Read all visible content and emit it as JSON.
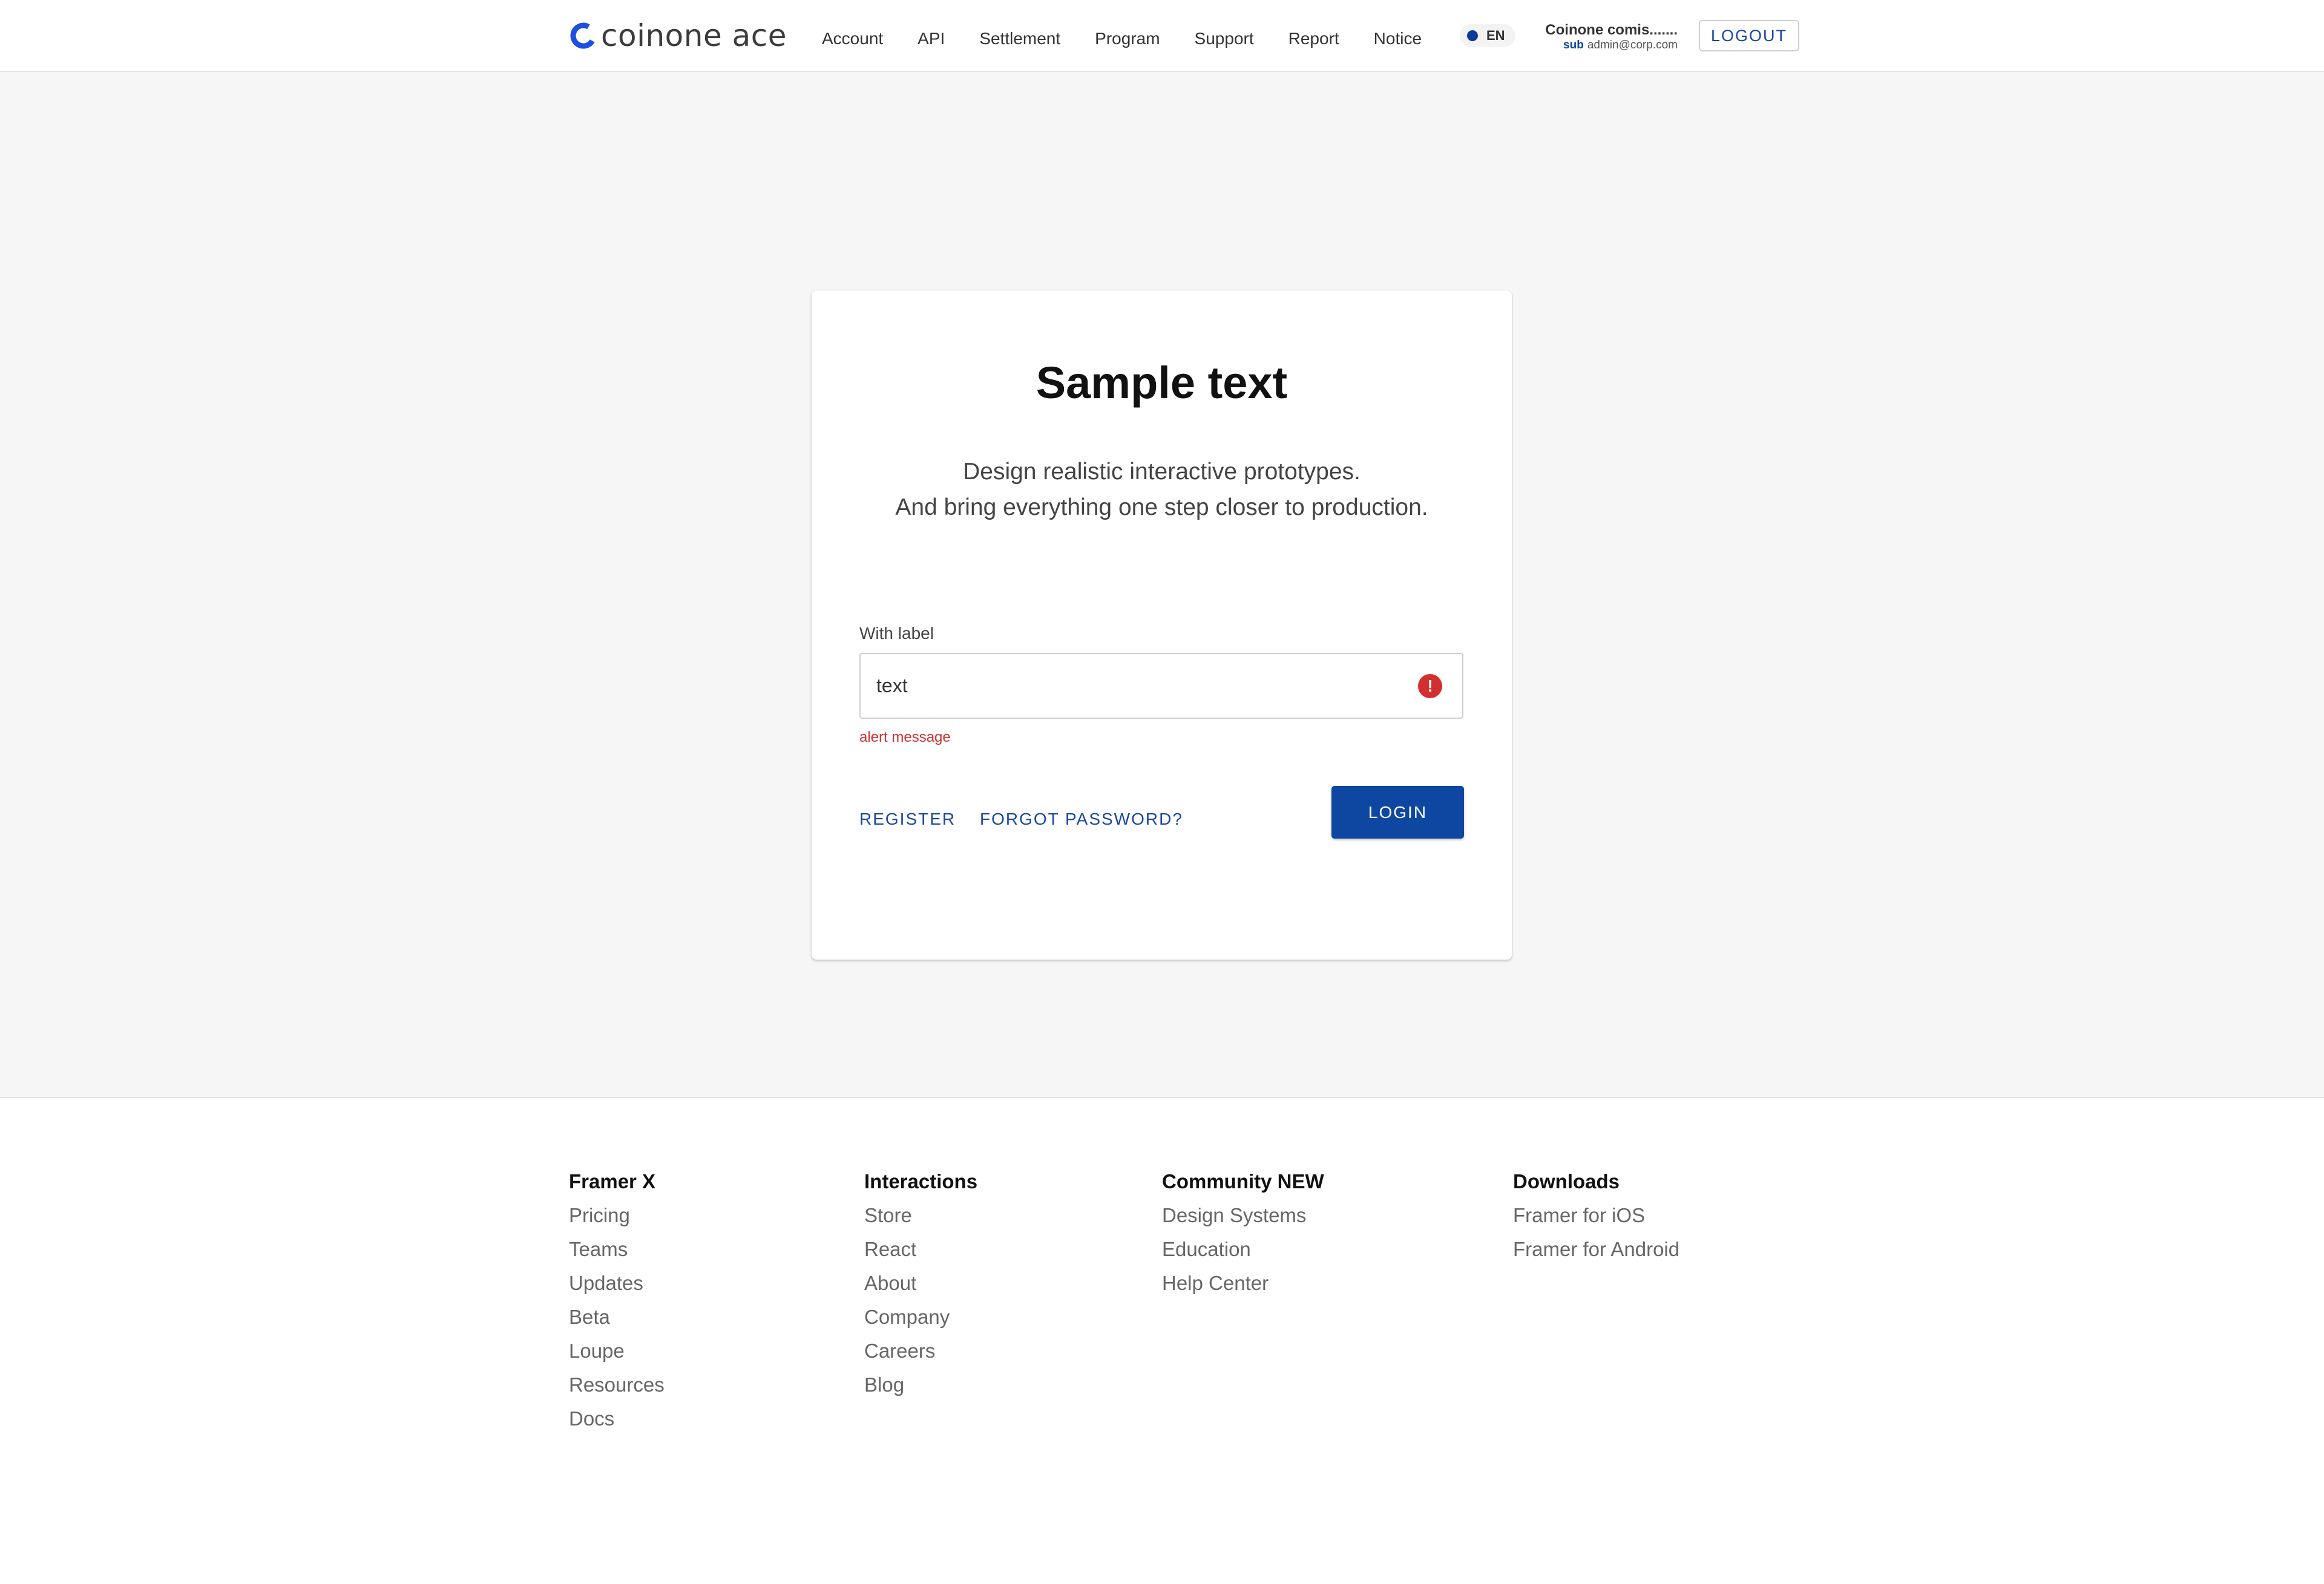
{
  "header": {
    "logo_text": "coinone ace",
    "nav": [
      "Account",
      "API",
      "Settlement",
      "Program",
      "Support",
      "Report",
      "Notice"
    ],
    "language": "EN",
    "user_name": "Coinone comis.......",
    "user_sub_tag": "sub",
    "user_email": "admin@corp.com",
    "logout_label": "LOGOUT",
    "brand_color": "#0d47a1"
  },
  "card": {
    "title": "Sample text",
    "desc_line1": "Design realistic interactive prototypes.",
    "desc_line2": "And bring everything one step closer to production.",
    "field_label": "With label",
    "field_value": "text",
    "alert_icon": "!",
    "alert_message": "alert message",
    "register_label": "REGISTER",
    "forgot_label": "FORGOT PASSWORD?",
    "login_label": "LOGIN",
    "alert_color": "#d32f2f"
  },
  "footer": {
    "columns": [
      {
        "title": "Framer X",
        "links": [
          "Pricing",
          "Teams",
          "Updates",
          "Beta",
          "Loupe",
          "Resources",
          "Docs"
        ]
      },
      {
        "title": "Interactions",
        "links": [
          "Store",
          "React",
          "About",
          "Company",
          "Careers",
          "Blog"
        ]
      },
      {
        "title": "Community NEW",
        "links": [
          "Design Systems",
          "Education",
          "Help Center"
        ]
      },
      {
        "title": "Downloads",
        "links": [
          "Framer for iOS",
          "Framer for Android"
        ]
      }
    ]
  }
}
